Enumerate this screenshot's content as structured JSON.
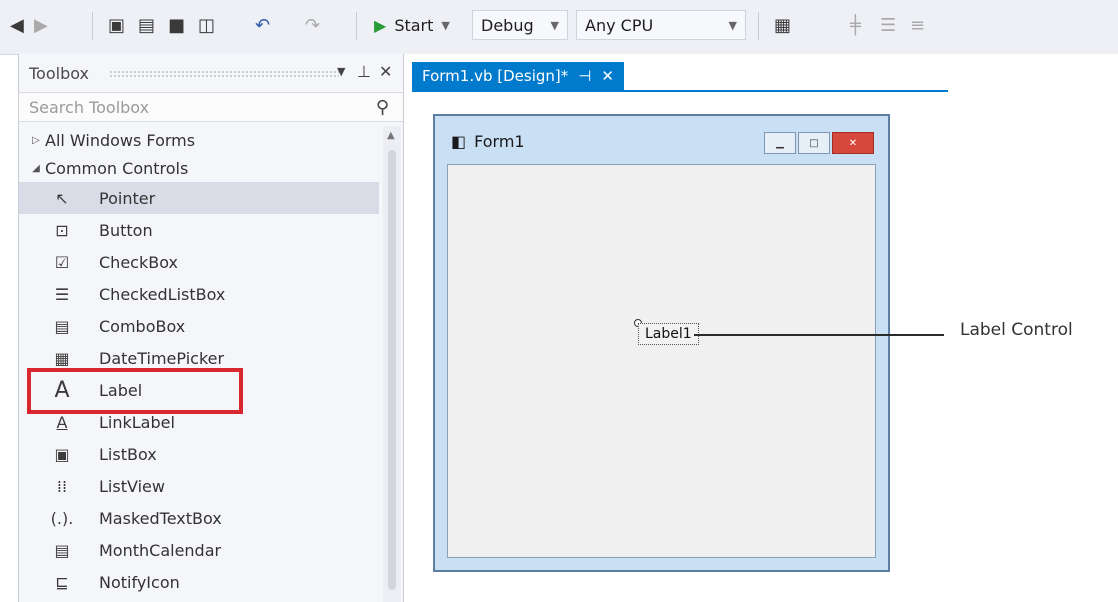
{
  "toolbar": {
    "start_label": "Start",
    "config_value": "Debug",
    "platform_value": "Any CPU",
    "icons": [
      "back-icon",
      "forward-icon",
      "new-project-icon",
      "open-icon",
      "save-icon",
      "save-all-icon",
      "undo-icon",
      "redo-icon",
      "start-icon",
      "layout-icon",
      "align-icon"
    ]
  },
  "toolbox": {
    "title": "Toolbox",
    "search_placeholder": "Search Toolbox",
    "categories": [
      {
        "label": "All Windows Forms",
        "expanded": false
      },
      {
        "label": "Common Controls",
        "expanded": true
      }
    ],
    "items": [
      {
        "label": "Pointer",
        "icon": "pointer-icon",
        "selected": true
      },
      {
        "label": "Button",
        "icon": "button-icon"
      },
      {
        "label": "CheckBox",
        "icon": "checkbox-icon"
      },
      {
        "label": "CheckedListBox",
        "icon": "checkedlistbox-icon"
      },
      {
        "label": "ComboBox",
        "icon": "combobox-icon"
      },
      {
        "label": "DateTimePicker",
        "icon": "datetimepicker-icon"
      },
      {
        "label": "Label",
        "icon": "label-icon"
      },
      {
        "label": "LinkLabel",
        "icon": "linklabel-icon"
      },
      {
        "label": "ListBox",
        "icon": "listbox-icon"
      },
      {
        "label": "ListView",
        "icon": "listview-icon"
      },
      {
        "label": "MaskedTextBox",
        "icon": "maskedtextbox-icon"
      },
      {
        "label": "MonthCalendar",
        "icon": "monthcalendar-icon"
      },
      {
        "label": "NotifyIcon",
        "icon": "notifyicon-icon"
      }
    ]
  },
  "document": {
    "tab_label": "Form1.vb [Design]*",
    "form_title": "Form1",
    "label_control_text": "Label1"
  },
  "annotation": {
    "callout_text": "Label Control"
  },
  "colors": {
    "accent": "#007acc",
    "highlight_box": "#d9272f"
  }
}
